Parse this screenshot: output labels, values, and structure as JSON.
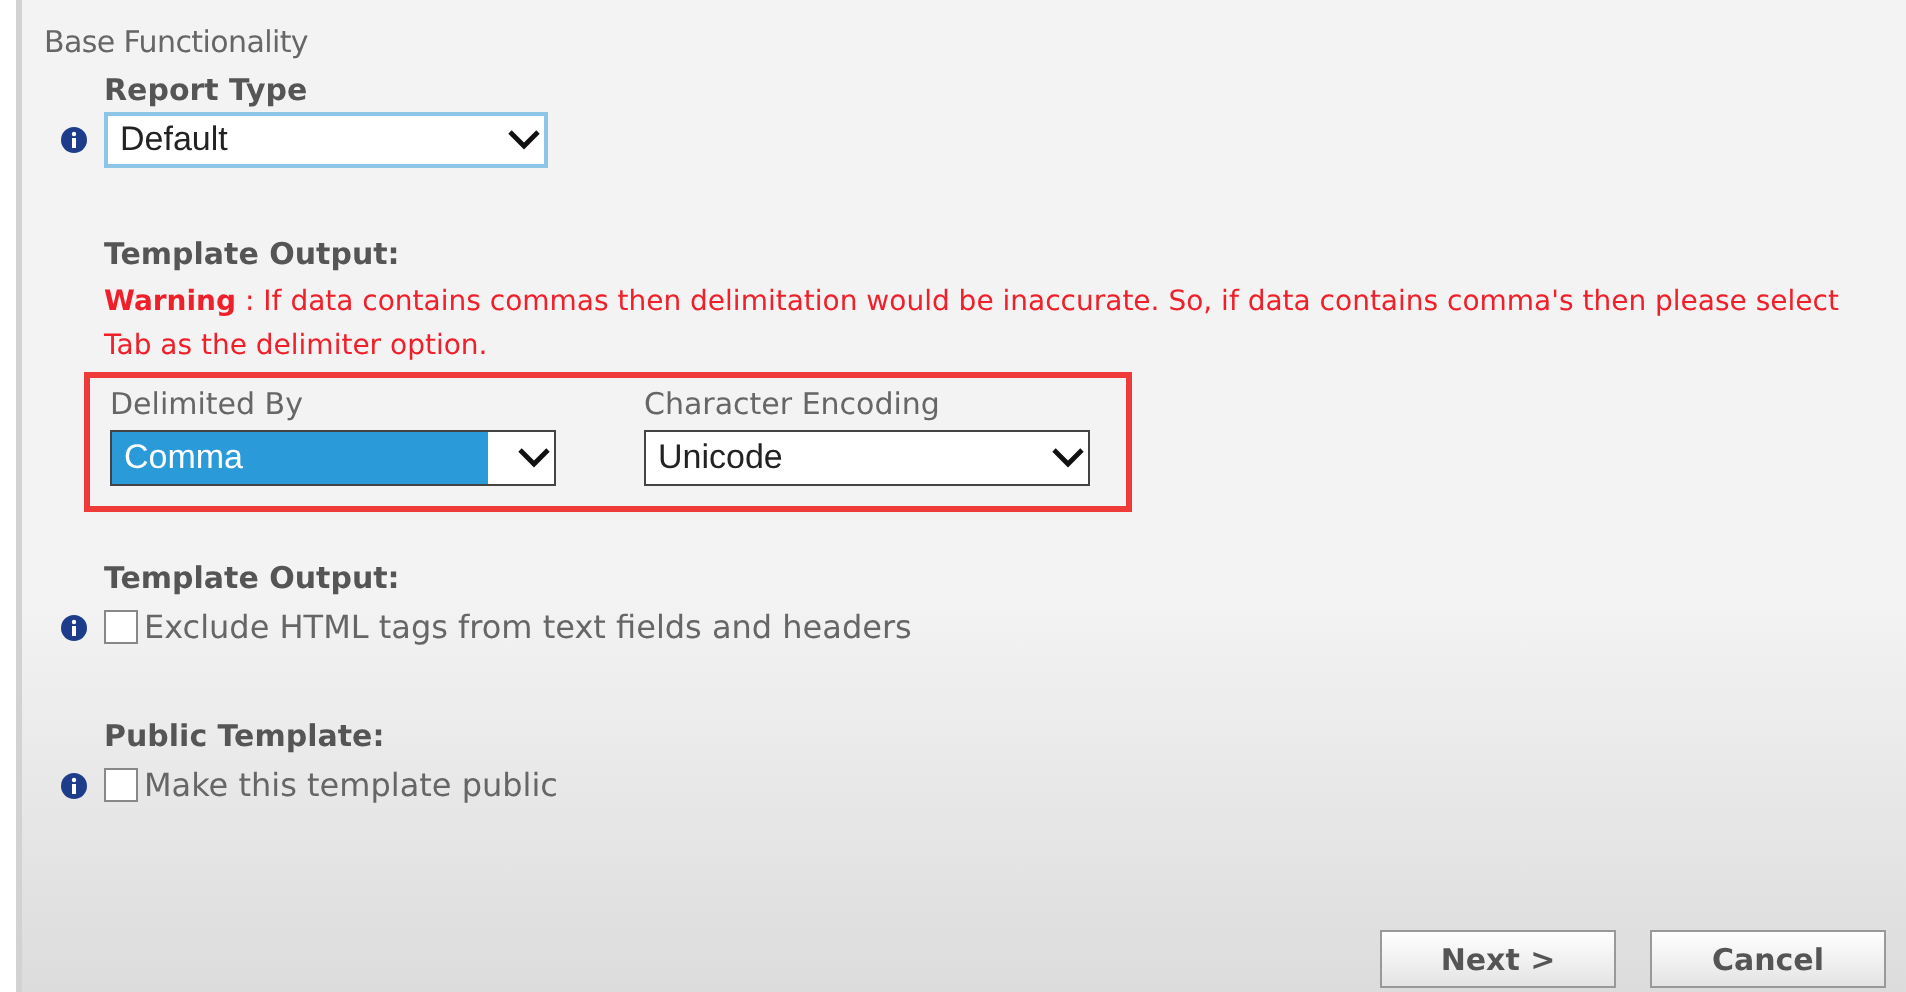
{
  "section_title": "Base Functionality",
  "report_type": {
    "label": "Report Type",
    "value": "Default",
    "selected": false
  },
  "template_output": {
    "label": "Template Output:",
    "warning": "**Warning** : If data contains commas then delimitation would be inaccurate. So, if data contains comma's then please select Tab as the delimiter option.",
    "dropdowns": [
      {
        "label": "Delimited By",
        "value": "Comma",
        "selected": true
      },
      {
        "label": "Character Encoding",
        "value": "Unicode",
        "selected": false
      }
    ]
  },
  "options": [
    {
      "heading": "Template Output:",
      "label": "Exclude HTML tags from text fields and headers",
      "checked": false
    },
    {
      "heading": "Public Template:",
      "label": "Make this template public",
      "checked": false
    }
  ],
  "buttons": [
    "Next >",
    "Cancel"
  ]
}
